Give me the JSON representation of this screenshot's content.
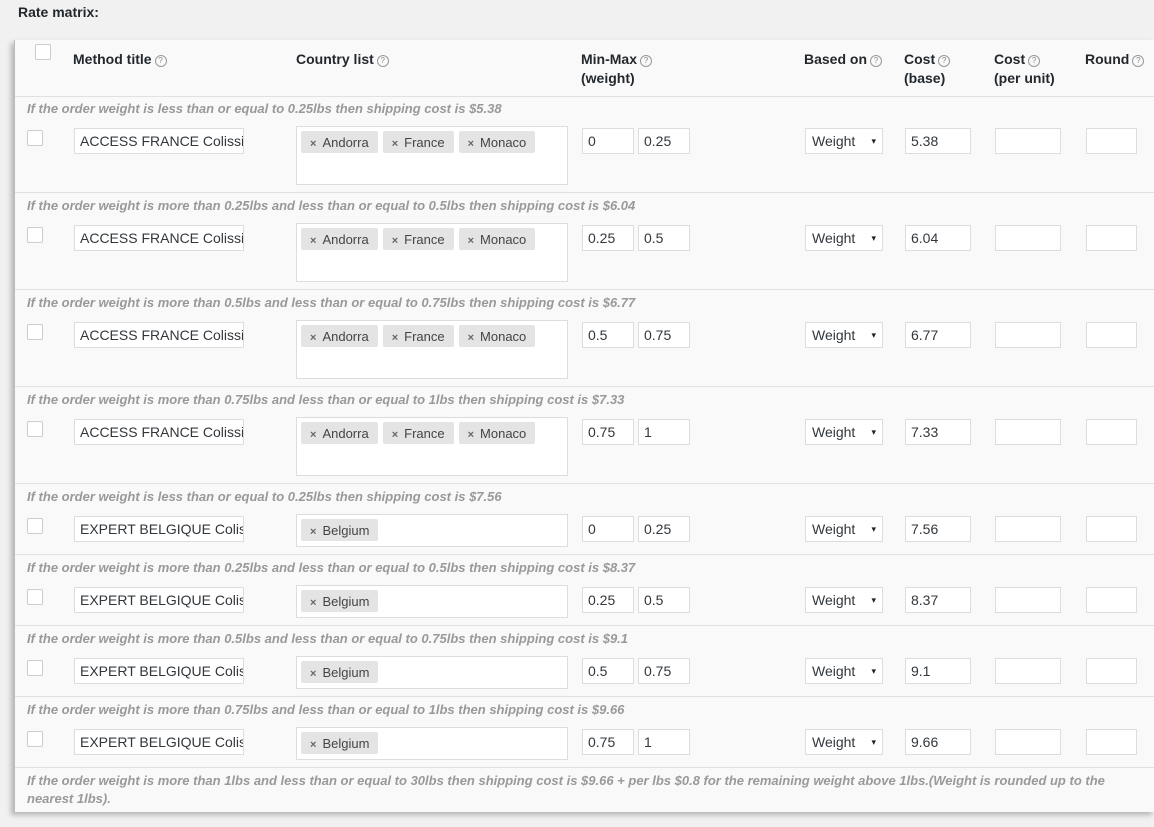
{
  "section_title": "Rate matrix:",
  "headers": {
    "method_title": "Method title",
    "country_list": "Country list",
    "min_max_line1": "Min-Max",
    "min_max_line2": "(weight)",
    "based_on": "Based on",
    "cost_base_line1": "Cost",
    "cost_base_line2": "(base)",
    "cost_unit_line1": "Cost",
    "cost_unit_line2": "(per unit)",
    "round": "Round",
    "help_glyph": "?"
  },
  "chip_remove_glyph": "×",
  "select_arrow_glyph": "▾",
  "rows": [
    {
      "desc": "If the order weight is less than or equal to 0.25lbs then shipping cost is $5.38",
      "title": "ACCESS FRANCE Colissimo",
      "countries": [
        "Andorra",
        "France",
        "Monaco"
      ],
      "min": "0",
      "max": "0.25",
      "based_on": "Weight",
      "cost_base": "5.38",
      "cost_unit": "",
      "round": ""
    },
    {
      "desc": "If the order weight is more than 0.25lbs and less than or equal to 0.5lbs then shipping cost is $6.04",
      "title": "ACCESS FRANCE Colissimo",
      "countries": [
        "Andorra",
        "France",
        "Monaco"
      ],
      "min": "0.25",
      "max": "0.5",
      "based_on": "Weight",
      "cost_base": "6.04",
      "cost_unit": "",
      "round": ""
    },
    {
      "desc": "If the order weight is more than 0.5lbs and less than or equal to 0.75lbs then shipping cost is $6.77",
      "title": "ACCESS FRANCE Colissimo",
      "countries": [
        "Andorra",
        "France",
        "Monaco"
      ],
      "min": "0.5",
      "max": "0.75",
      "based_on": "Weight",
      "cost_base": "6.77",
      "cost_unit": "",
      "round": ""
    },
    {
      "desc": "If the order weight is more than 0.75lbs and less than or equal to 1lbs then shipping cost is $7.33",
      "title": "ACCESS FRANCE Colissimo",
      "countries": [
        "Andorra",
        "France",
        "Monaco"
      ],
      "min": "0.75",
      "max": "1",
      "based_on": "Weight",
      "cost_base": "7.33",
      "cost_unit": "",
      "round": ""
    },
    {
      "desc": "If the order weight is less than or equal to 0.25lbs then shipping cost is $7.56",
      "title": "EXPERT BELGIQUE Colissimo",
      "countries": [
        "Belgium"
      ],
      "min": "0",
      "max": "0.25",
      "based_on": "Weight",
      "cost_base": "7.56",
      "cost_unit": "",
      "round": ""
    },
    {
      "desc": "If the order weight is more than 0.25lbs and less than or equal to 0.5lbs then shipping cost is $8.37",
      "title": "EXPERT BELGIQUE Colissimo",
      "countries": [
        "Belgium"
      ],
      "min": "0.25",
      "max": "0.5",
      "based_on": "Weight",
      "cost_base": "8.37",
      "cost_unit": "",
      "round": ""
    },
    {
      "desc": "If the order weight is more than 0.5lbs and less than or equal to 0.75lbs then shipping cost is $9.1",
      "title": "EXPERT BELGIQUE Colissimo",
      "countries": [
        "Belgium"
      ],
      "min": "0.5",
      "max": "0.75",
      "based_on": "Weight",
      "cost_base": "9.1",
      "cost_unit": "",
      "round": ""
    },
    {
      "desc": "If the order weight is more than 0.75lbs and less than or equal to 1lbs then shipping cost is $9.66",
      "title": "EXPERT BELGIQUE Colissimo",
      "countries": [
        "Belgium"
      ],
      "min": "0.75",
      "max": "1",
      "based_on": "Weight",
      "cost_base": "9.66",
      "cost_unit": "",
      "round": ""
    }
  ],
  "footer_desc": "If the order weight is more than 1lbs and less than or equal to 30lbs then shipping cost is $9.66 + per lbs $0.8 for the remaining weight above 1lbs.(Weight is rounded up to the nearest 1lbs)."
}
